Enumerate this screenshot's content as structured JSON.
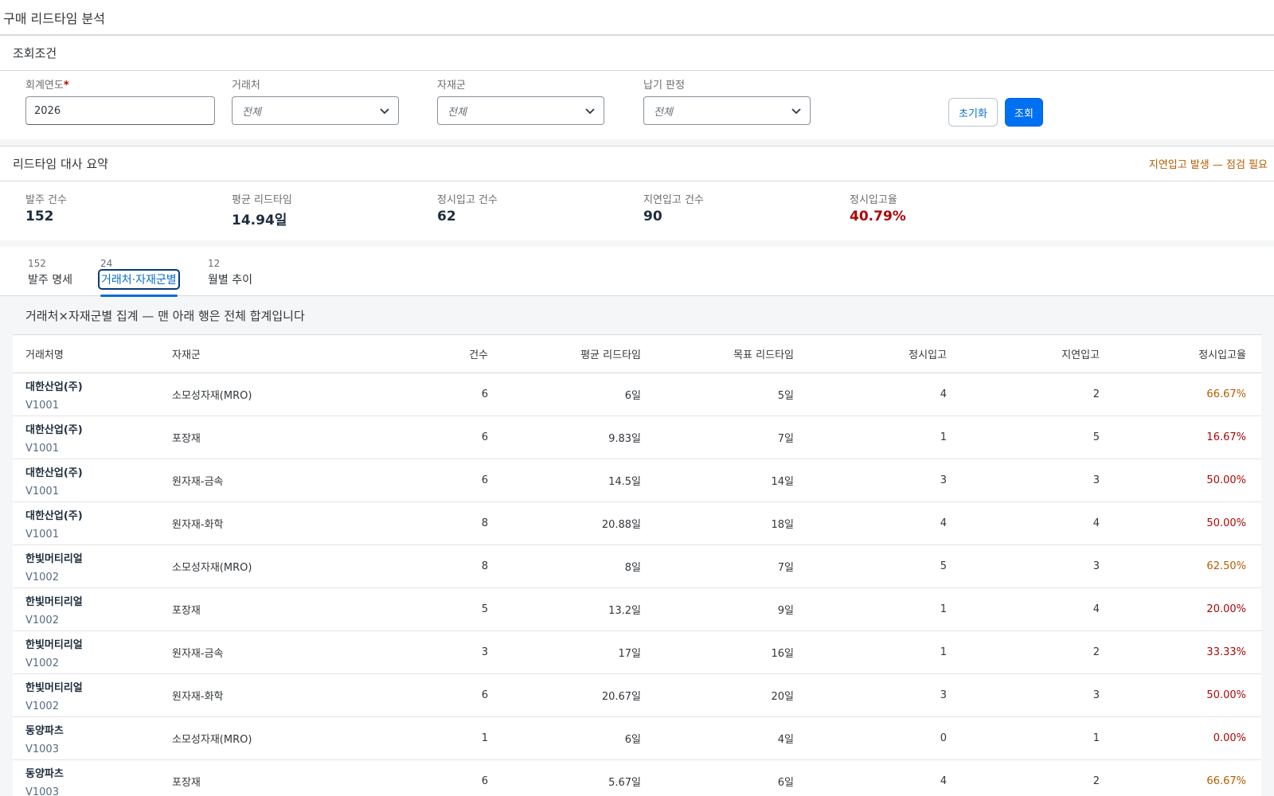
{
  "page": {
    "title": "구매 리드타임 분석"
  },
  "filters": {
    "title": "조회조건",
    "fiscal_year": {
      "label": "회계연도",
      "required_mark": "*",
      "value": "2026"
    },
    "vendor": {
      "label": "거래처",
      "value": "전체"
    },
    "material_group": {
      "label": "자재군",
      "value": "전체"
    },
    "delivery_judgement": {
      "label": "납기 판정",
      "value": "전체"
    },
    "reset_label": "초기화",
    "search_label": "조회"
  },
  "summary": {
    "title": "리드타임 대사 요약",
    "warning": "지연입고 발생 — 점검 필요",
    "kpis": [
      {
        "label": "발주 건수",
        "value": "152"
      },
      {
        "label": "평균 리드타임",
        "value": "14.94일"
      },
      {
        "label": "정시입고 건수",
        "value": "62"
      },
      {
        "label": "지연입고 건수",
        "value": "90"
      },
      {
        "label": "정시입고율",
        "value": "40.79%"
      }
    ]
  },
  "tabs": [
    {
      "count": "152",
      "label": "발주 명세"
    },
    {
      "count": "24",
      "label": "거래처·자재군별"
    },
    {
      "count": "12",
      "label": "월별 추이"
    }
  ],
  "aggregate": {
    "title": "거래처×자재군별 집계 — 맨 아래 행은 전체 합계입니다",
    "columns": [
      "거래처명",
      "자재군",
      "건수",
      "평균 리드타임",
      "목표 리드타임",
      "정시입고",
      "지연입고",
      "정시입고율"
    ],
    "rows": [
      {
        "vendor": "대한산업(주)",
        "code": "V1001",
        "group": "소모성자재(MRO)",
        "count": "6",
        "avg": "6일",
        "target": "5일",
        "ontime": "4",
        "late": "2",
        "rate": "66.67%"
      },
      {
        "vendor": "대한산업(주)",
        "code": "V1001",
        "group": "포장재",
        "count": "6",
        "avg": "9.83일",
        "target": "7일",
        "ontime": "1",
        "late": "5",
        "rate": "16.67%"
      },
      {
        "vendor": "대한산업(주)",
        "code": "V1001",
        "group": "원자재-금속",
        "count": "6",
        "avg": "14.5일",
        "target": "14일",
        "ontime": "3",
        "late": "3",
        "rate": "50.00%"
      },
      {
        "vendor": "대한산업(주)",
        "code": "V1001",
        "group": "원자재-화학",
        "count": "8",
        "avg": "20.88일",
        "target": "18일",
        "ontime": "4",
        "late": "4",
        "rate": "50.00%"
      },
      {
        "vendor": "한빛머티리얼",
        "code": "V1002",
        "group": "소모성자재(MRO)",
        "count": "8",
        "avg": "8일",
        "target": "7일",
        "ontime": "5",
        "late": "3",
        "rate": "62.50%"
      },
      {
        "vendor": "한빛머티리얼",
        "code": "V1002",
        "group": "포장재",
        "count": "5",
        "avg": "13.2일",
        "target": "9일",
        "ontime": "1",
        "late": "4",
        "rate": "20.00%"
      },
      {
        "vendor": "한빛머티리얼",
        "code": "V1002",
        "group": "원자재-금속",
        "count": "3",
        "avg": "17일",
        "target": "16일",
        "ontime": "1",
        "late": "2",
        "rate": "33.33%"
      },
      {
        "vendor": "한빛머티리얼",
        "code": "V1002",
        "group": "원자재-화학",
        "count": "6",
        "avg": "20.67일",
        "target": "20일",
        "ontime": "3",
        "late": "3",
        "rate": "50.00%"
      },
      {
        "vendor": "동양파츠",
        "code": "V1003",
        "group": "소모성자재(MRO)",
        "count": "1",
        "avg": "6일",
        "target": "4일",
        "ontime": "0",
        "late": "1",
        "rate": "0.00%"
      },
      {
        "vendor": "동양파츠",
        "code": "V1003",
        "group": "포장재",
        "count": "6",
        "avg": "5.67일",
        "target": "6일",
        "ontime": "4",
        "late": "2",
        "rate": "66.67%"
      }
    ]
  },
  "colors": {
    "accent": "#0070f2",
    "warning": "#b45c00",
    "negative": "#aa0808"
  }
}
